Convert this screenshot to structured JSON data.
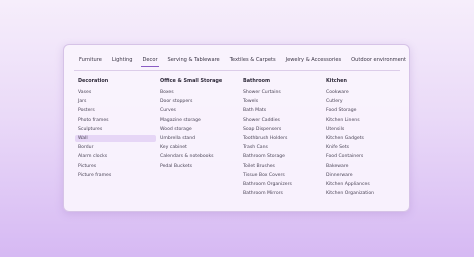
{
  "tabs": [
    {
      "label": "Furniture",
      "active": false
    },
    {
      "label": "Lighting",
      "active": false
    },
    {
      "label": "Decor",
      "active": true
    },
    {
      "label": "Serving & Tableware",
      "active": false
    },
    {
      "label": "Textiles & Carpets",
      "active": false
    },
    {
      "label": "Jewelry & Accessories",
      "active": false
    },
    {
      "label": "Outdoor environment",
      "active": false
    }
  ],
  "columns": [
    {
      "heading": "Decoration",
      "items": [
        "Vases",
        "Jars",
        "Posters",
        "Photo frames",
        "Sculptures",
        "Wall",
        "Bordur",
        "Alarm clocks",
        "Pictures",
        "Picture frames"
      ],
      "selected_index": 5
    },
    {
      "heading": "Office & Small Storage",
      "items": [
        "Boxes",
        "Door stoppers",
        "Curves",
        "Magazine storage",
        "Wood storage",
        "Umbrella stand",
        "Key cabinet",
        "Calendars & notebooks",
        "Pedal Buckets"
      ],
      "selected_index": -1
    },
    {
      "heading": "Bathroom",
      "items": [
        "Shower Curtains",
        "Towels",
        "Bath Mats",
        "Shower Caddies",
        "Soap Dispensers",
        "Toothbrush Holders",
        "Trash Cans",
        "Bathroom Storage",
        "Toilet Brushes",
        "Tissue Box Covers",
        "Bathroom Organizers",
        "Bathroom Mirrors"
      ],
      "selected_index": -1
    },
    {
      "heading": "Kitchen",
      "items": [
        "Cookware",
        "Cutlery",
        "Food Storage",
        "Kitchen Linens",
        "Utensils",
        "Kitchen Gadgets",
        "Knife Sets",
        "Food Containers",
        "Bakeware",
        "Dinnerware",
        "Kitchen Appliances",
        "Kitchen Organization"
      ],
      "selected_index": -1
    }
  ]
}
